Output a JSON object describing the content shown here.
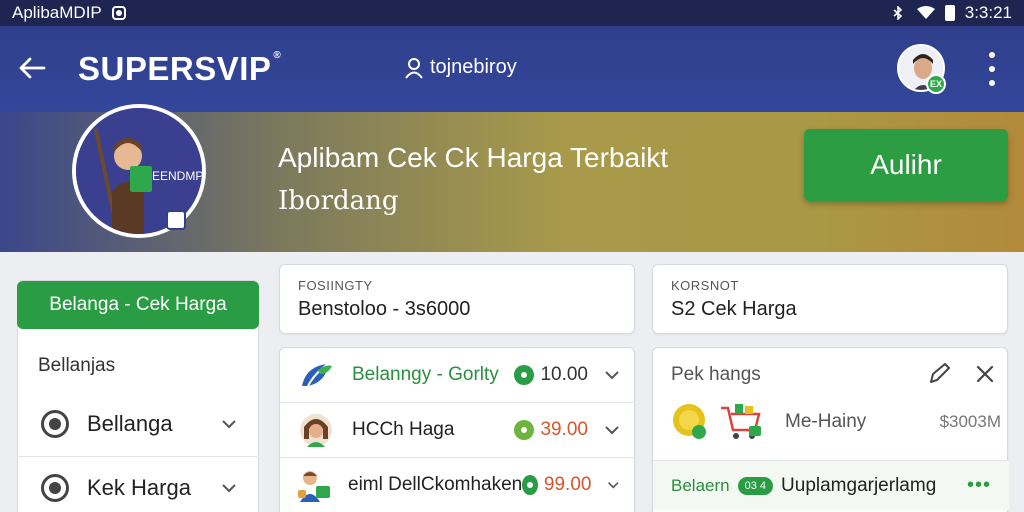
{
  "status_bar": {
    "app_name": "AplibaMDIP",
    "time": "3:3:21"
  },
  "app_bar": {
    "brand": "SUPERSVIP",
    "brand_mark": "®",
    "user_link": "tojnebiroy"
  },
  "banner": {
    "title": "Aplibam Cek Ck Harga Terbaikt",
    "subtitle": "Ibordang",
    "cta_label": "Aulihr",
    "logo_text": "EENDMP"
  },
  "sidebar": {
    "active_label": "Belanga - Cek Harga",
    "heading": "Bellanjas",
    "items": [
      {
        "label": "Bellanga"
      },
      {
        "label": "Kek Harga"
      }
    ]
  },
  "summary_cards": [
    {
      "label": "FOSIINGTY",
      "value": "Benstoloo - 3s6000"
    },
    {
      "label": "KORSNOT",
      "value": "S2   Cek Harga"
    }
  ],
  "price_list": [
    {
      "name": "Belanngy - Gorlty",
      "price": "10.00",
      "accent": "#2a9c44"
    },
    {
      "name": "HCCh Haga",
      "price": "39.00",
      "accent": "#6fb33f"
    },
    {
      "name": "eiml DellCkomhaken",
      "price": "99.00",
      "accent": "#2a9c44"
    }
  ],
  "detail_card": {
    "title": "Pek hangs",
    "product_name": "Me-Hainy",
    "product_price": "$3003M",
    "footer_label": "Belaern",
    "footer_badge": "03 4",
    "footer_text": "Uuplamgarjerlamg",
    "footer_more": "•••"
  },
  "colors": {
    "primary": "#2f3f8c",
    "accent_green": "#2c9d42",
    "price_orange": "#d4572a"
  }
}
